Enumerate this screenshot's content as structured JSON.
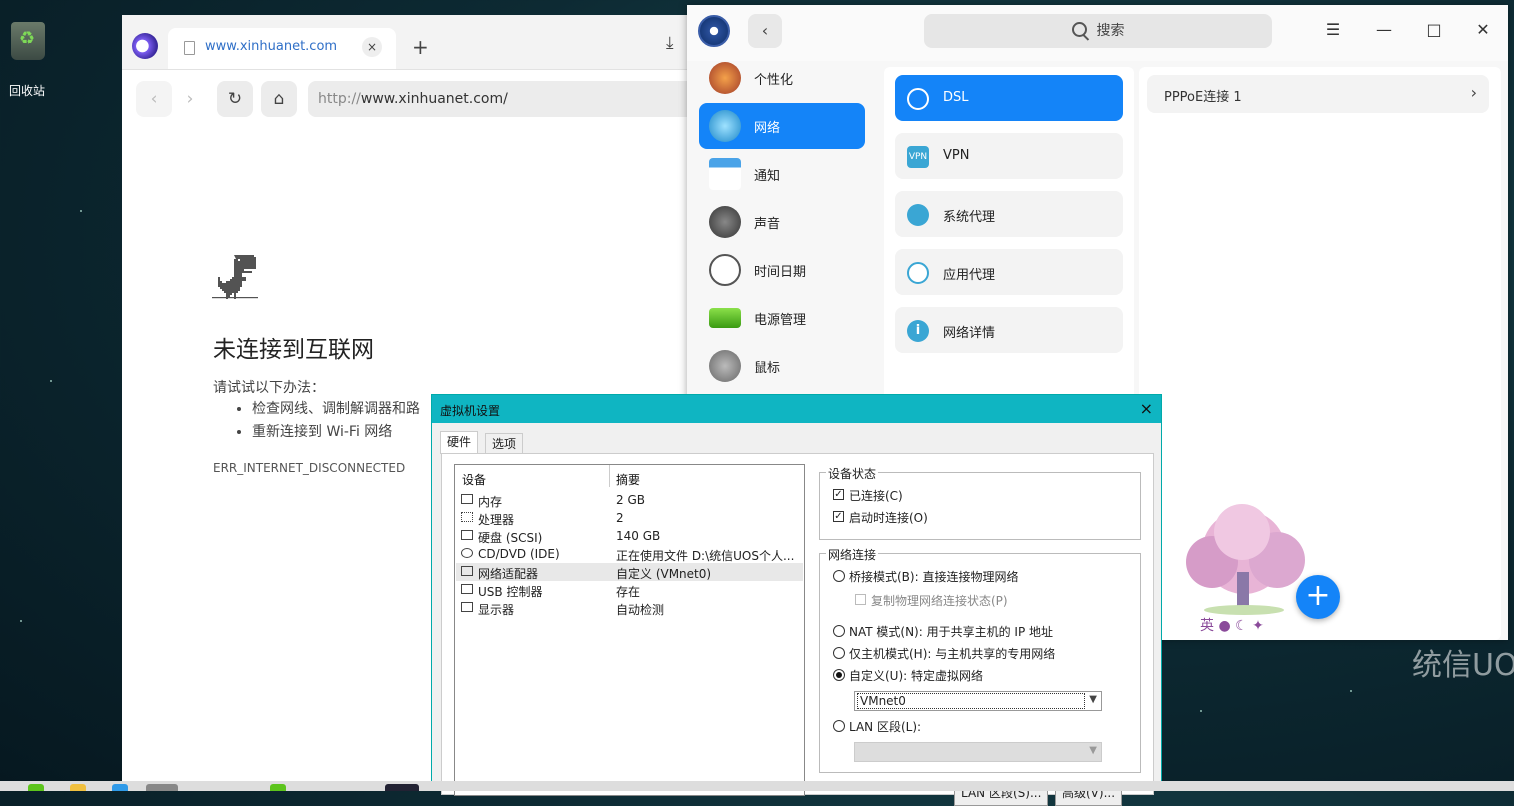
{
  "desktop": {
    "trash_label": "回收站",
    "brand_text": "统信UOS"
  },
  "browser": {
    "tab_title": "www.xinhuanet.com",
    "tab_close": "×",
    "new_tab": "+",
    "url_proto": "http://",
    "url_host": "www.xinhuanet.com/",
    "error": {
      "title": "未连接到互联网",
      "subtitle": "请试试以下办法：",
      "tips": [
        "检查网线、调制解调器和路",
        "重新连接到 Wi-Fi 网络"
      ],
      "code": "ERR_INTERNET_DISCONNECTED"
    }
  },
  "control_center": {
    "search_placeholder": "搜索",
    "sidebar": [
      {
        "label": "个性化",
        "icon": "palette-icon",
        "color": "#d35b3a"
      },
      {
        "label": "网络",
        "icon": "network-globe-icon",
        "color": "#2fa8d8",
        "active": true
      },
      {
        "label": "通知",
        "icon": "notification-icon",
        "color": "#4aa3e8"
      },
      {
        "label": "声音",
        "icon": "speaker-icon",
        "color": "#555555"
      },
      {
        "label": "时间日期",
        "icon": "clock-icon",
        "color": "#eeeeee"
      },
      {
        "label": "电源管理",
        "icon": "battery-icon",
        "color": "#5cc41c"
      },
      {
        "label": "鼠标",
        "icon": "mouse-icon",
        "color": "#777777"
      }
    ],
    "network_menu": [
      {
        "label": "DSL",
        "icon": "dsl-icon",
        "active": true
      },
      {
        "label": "VPN",
        "icon": "vpn-icon",
        "badge": "VPN"
      },
      {
        "label": "系统代理",
        "icon": "system-proxy-icon"
      },
      {
        "label": "应用代理",
        "icon": "app-proxy-icon"
      },
      {
        "label": "网络详情",
        "icon": "info-icon",
        "badge": "i"
      }
    ],
    "connections": [
      {
        "label": "PPPoE连接 1"
      }
    ],
    "fab_label": "+",
    "accent": "#1484f8"
  },
  "vm_dialog": {
    "title": "虚拟机设置",
    "close": "×",
    "tabs": [
      "硬件",
      "选项"
    ],
    "columns": [
      "设备",
      "摘要"
    ],
    "devices": [
      {
        "name": "内存",
        "summary": "2 GB"
      },
      {
        "name": "处理器",
        "summary": "2"
      },
      {
        "name": "硬盘 (SCSI)",
        "summary": "140 GB"
      },
      {
        "name": "CD/DVD (IDE)",
        "summary": "正在使用文件 D:\\统信UOS个人..."
      },
      {
        "name": "网络适配器",
        "summary": "自定义 (VMnet0)",
        "selected": true
      },
      {
        "name": "USB 控制器",
        "summary": "存在"
      },
      {
        "name": "显示器",
        "summary": "自动检测"
      }
    ],
    "device_status": {
      "title": "设备状态",
      "connected": "已连接(C)",
      "connect_on_start": "启动时连接(O)"
    },
    "network": {
      "title": "网络连接",
      "bridged": "桥接模式(B): 直接连接物理网络",
      "replicate": "复制物理网络连接状态(P)",
      "nat": "NAT 模式(N): 用于共享主机的 IP 地址",
      "hostonly": "仅主机模式(H): 与主机共享的专用网络",
      "custom": "自定义(U): 特定虚拟网络",
      "custom_value": "VMnet0",
      "lan": "LAN 区段(L):"
    },
    "buttons": [
      "LAN 区段(S)...",
      "高级(V)..."
    ]
  }
}
